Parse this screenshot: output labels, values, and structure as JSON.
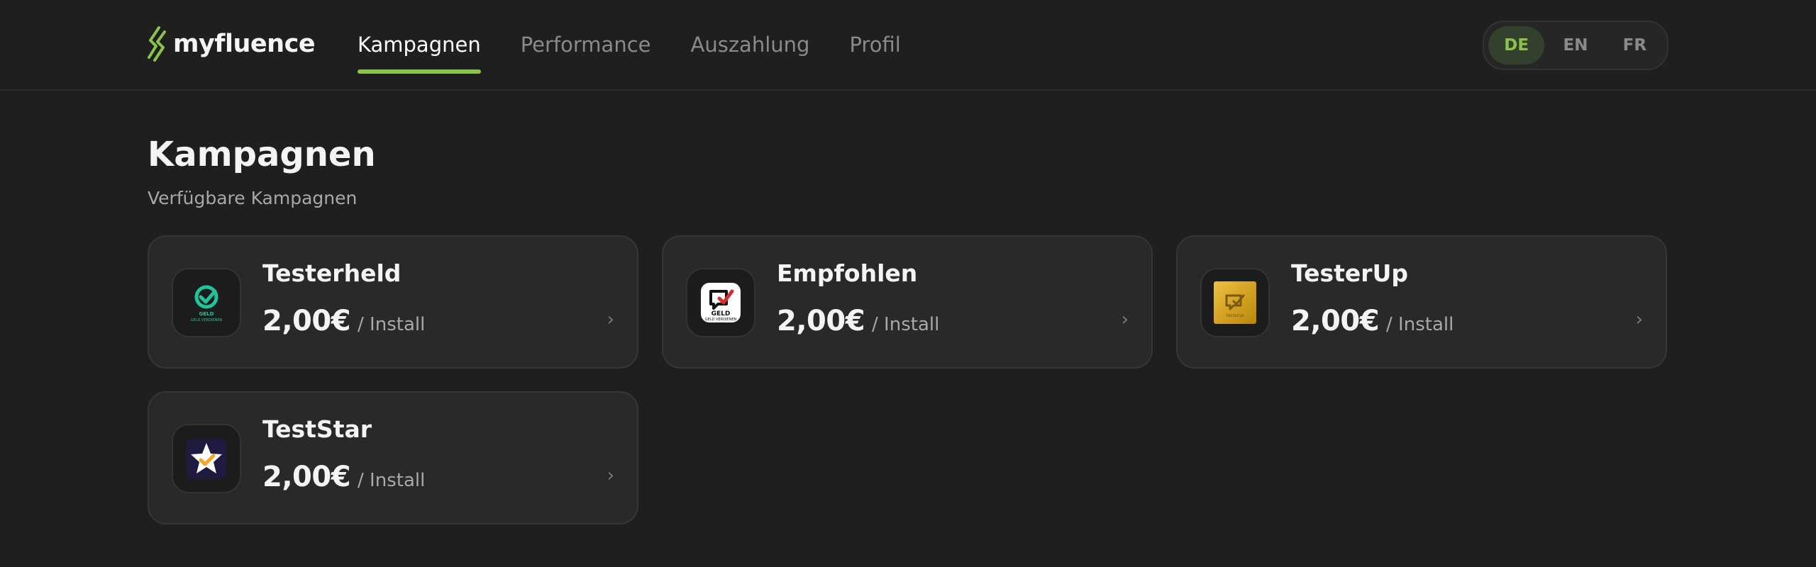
{
  "brand": {
    "name": "myfluence",
    "accent": "#8bc34a"
  },
  "nav": {
    "items": [
      {
        "label": "Kampagnen",
        "active": true
      },
      {
        "label": "Performance",
        "active": false
      },
      {
        "label": "Auszahlung",
        "active": false
      },
      {
        "label": "Profil",
        "active": false
      }
    ]
  },
  "languages": {
    "items": [
      {
        "label": "DE",
        "active": true
      },
      {
        "label": "EN",
        "active": false
      },
      {
        "label": "FR",
        "active": false
      }
    ]
  },
  "page": {
    "title": "Kampagnen",
    "subtitle": "Verfügbare Kampagnen"
  },
  "campaigns": [
    {
      "name": "Testerheld",
      "price": "2,00€",
      "unit": "/ Install",
      "icon": "testerheld-logo-icon",
      "icon_color": "#22c39a",
      "icon_text": "GELD VERDIENEN"
    },
    {
      "name": "Empfohlen",
      "price": "2,00€",
      "unit": "/ Install",
      "icon": "empfohlen-logo-icon",
      "icon_color": "#d32f2f",
      "icon_text": "GELD VERDIENEN"
    },
    {
      "name": "TesterUp",
      "price": "2,00€",
      "unit": "/ Install",
      "icon": "testerup-logo-icon",
      "icon_color": "#d9a520",
      "icon_text": "testerup"
    },
    {
      "name": "TestStar",
      "price": "2,00€",
      "unit": "/ Install",
      "icon": "teststar-logo-icon",
      "icon_color": "#f5a623"
    }
  ],
  "chevron": "›"
}
